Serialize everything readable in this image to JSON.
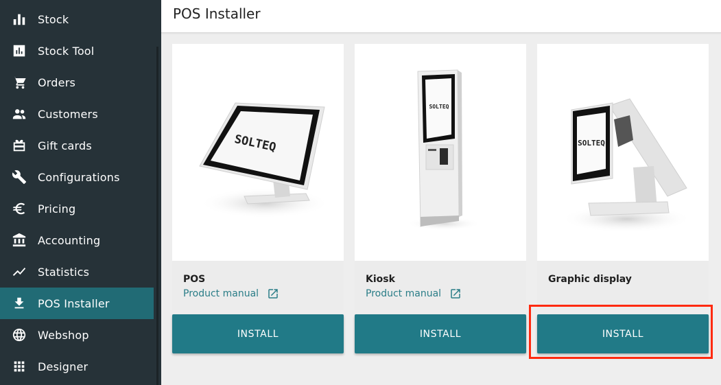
{
  "sidebar": {
    "items": [
      {
        "label": "Stock",
        "icon": "bar-chart-icon"
      },
      {
        "label": "Stock Tool",
        "icon": "chart-box-icon"
      },
      {
        "label": "Orders",
        "icon": "cart-icon"
      },
      {
        "label": "Customers",
        "icon": "people-icon"
      },
      {
        "label": "Gift cards",
        "icon": "gift-card-icon"
      },
      {
        "label": "Configurations",
        "icon": "wrench-icon"
      },
      {
        "label": "Pricing",
        "icon": "euro-icon"
      },
      {
        "label": "Accounting",
        "icon": "bank-icon"
      },
      {
        "label": "Statistics",
        "icon": "trend-line-icon"
      },
      {
        "label": "POS Installer",
        "icon": "download-icon",
        "active": true
      },
      {
        "label": "Webshop",
        "icon": "globe-icon"
      },
      {
        "label": "Designer",
        "icon": "grid-icon"
      }
    ]
  },
  "header": {
    "title": "POS Installer"
  },
  "cards": [
    {
      "name": "POS",
      "manual_label": "Product manual",
      "install_label": "INSTALL",
      "device_brand": "SOLTEQ"
    },
    {
      "name": "Kiosk",
      "manual_label": "Product manual",
      "install_label": "INSTALL",
      "device_brand": "SOLTEQ"
    },
    {
      "name": "Graphic display",
      "install_label": "INSTALL",
      "device_brand": "SOLTEQ"
    }
  ],
  "colors": {
    "sidebar_bg": "#263238",
    "active_item_bg": "#216b75",
    "button_bg": "#217a87",
    "link": "#2a7d87",
    "highlight": "#ff2a0f"
  }
}
